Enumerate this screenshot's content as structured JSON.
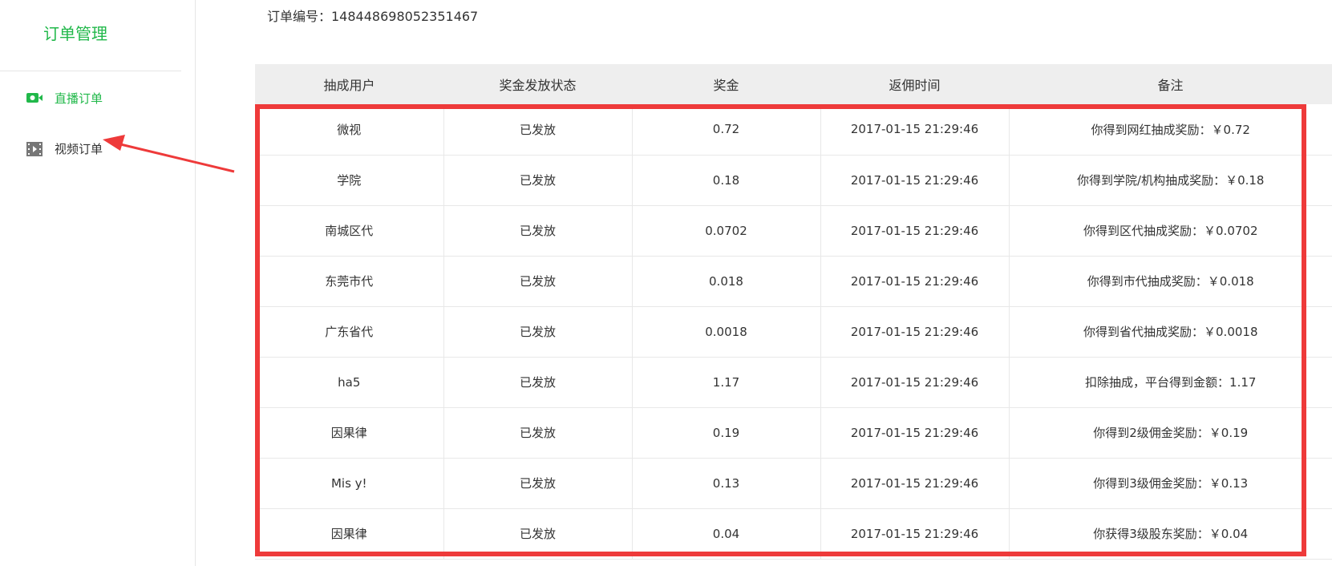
{
  "sidebar": {
    "title": "订单管理",
    "items": [
      {
        "label": "直播订单",
        "icon": "camera-icon"
      },
      {
        "label": "视频订单",
        "icon": "film-icon"
      }
    ]
  },
  "order_no": "订单编号：148448698052351467",
  "table": {
    "headers": [
      "抽成用户",
      "奖金发放状态",
      "奖金",
      "返佣时间",
      "备注"
    ],
    "rows": [
      [
        "微视",
        "已发放",
        "0.72",
        "2017-01-15 21:29:46",
        "你得到网红抽成奖励：￥0.72"
      ],
      [
        "学院",
        "已发放",
        "0.18",
        "2017-01-15 21:29:46",
        "你得到学院/机构抽成奖励：￥0.18"
      ],
      [
        "南城区代",
        "已发放",
        "0.0702",
        "2017-01-15 21:29:46",
        "你得到区代抽成奖励：￥0.0702"
      ],
      [
        "东莞市代",
        "已发放",
        "0.018",
        "2017-01-15 21:29:46",
        "你得到市代抽成奖励：￥0.018"
      ],
      [
        "广东省代",
        "已发放",
        "0.0018",
        "2017-01-15 21:29:46",
        "你得到省代抽成奖励：￥0.0018"
      ],
      [
        "ha5",
        "已发放",
        "1.17",
        "2017-01-15 21:29:46",
        "扣除抽成，平台得到金额：1.17"
      ],
      [
        "因果律",
        "已发放",
        "0.19",
        "2017-01-15 21:29:46",
        "你得到2级佣金奖励：￥0.19"
      ],
      [
        "Mis y!",
        "已发放",
        "0.13",
        "2017-01-15 21:29:46",
        "你得到3级佣金奖励：￥0.13"
      ],
      [
        "因果律",
        "已发放",
        "0.04",
        "2017-01-15 21:29:46",
        "你获得3级股东奖励：￥0.04"
      ]
    ]
  },
  "colors": {
    "accent": "#21b84a",
    "highlight_border": "#ee3a3a",
    "header_bg": "#eeeeee"
  }
}
